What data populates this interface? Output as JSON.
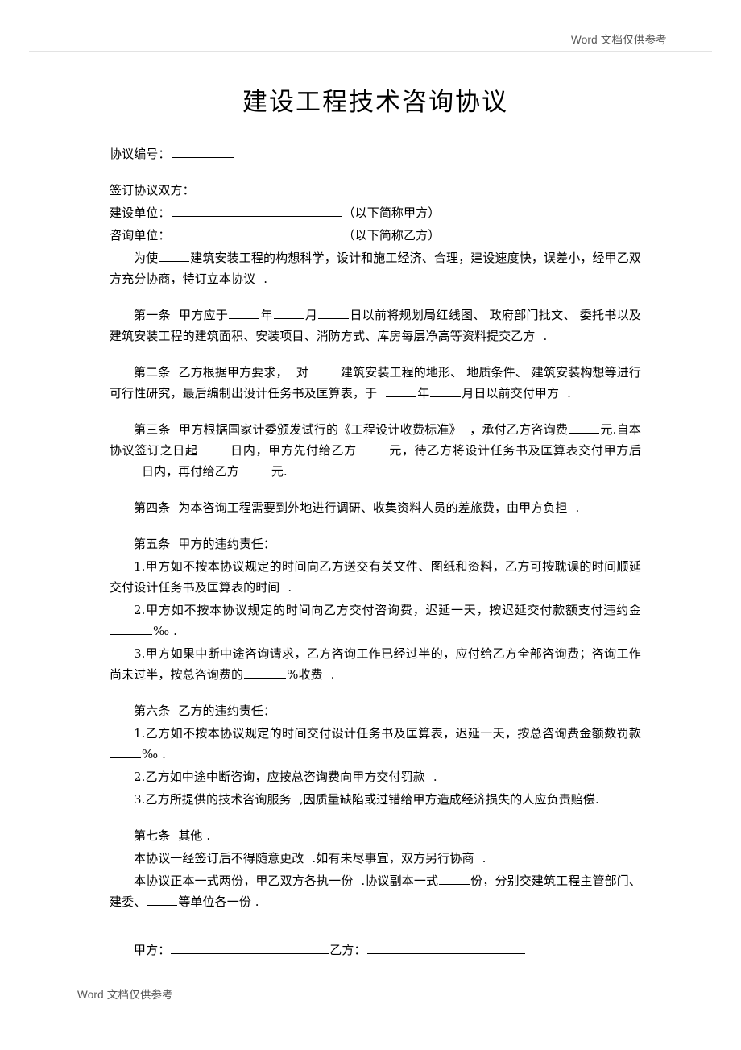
{
  "header": {
    "watermark": "Word 文档仅供参考"
  },
  "footer": {
    "watermark": "Word 文档仅供参考"
  },
  "document": {
    "title": "建设工程技术咨询协议",
    "number_label": "协议编号：",
    "parties_heading": "签订协议双方：",
    "party_a_label": "建设单位：",
    "party_a_note": "（以下简称甲方）",
    "party_b_label": "咨询单位：",
    "party_b_note": "（以下简称乙方）",
    "preamble": {
      "part1": "为使",
      "part2": "建筑安装工程的构想科学，设计和施工经济、合理，建设速度快，误差小，经甲乙双方充分协商，特订立本协议",
      "part3": "."
    },
    "article1": {
      "label": "第一条",
      "t1": "甲方应于",
      "t2": "年",
      "t3": "月",
      "t4": "日以前将规划局红线图、 政府部门批文、 委托书以及建筑安装工程的建筑面积、安装项目、消防方式、库房每层净高等资料提交乙方",
      "t5": "."
    },
    "article2": {
      "label": "第二条",
      "t1": "乙方根据甲方要求，",
      "t2": "对",
      "t3": "建筑安装工程的地形、 地质条件、 建筑安装构想等进行可行性研究，最后编制出设计任务书及匡算表，于",
      "t4": "年",
      "t5": "月日以前交付甲方",
      "t6": "."
    },
    "article3": {
      "label": "第三条",
      "t1": "甲方根据国家计委颁发试行的《工程设计收费标准》",
      "t2": "，承付乙方咨询费",
      "t3": "元.自本协议签订之日起",
      "t4": "日内，甲方先付给乙方",
      "t5": "元，待乙方将设计任务书及匡算表交付甲方后",
      "t6": "日内，再付给乙方",
      "t7": "元."
    },
    "article4": {
      "label": "第四条",
      "t1": "为本咨询工程需要到外地进行调研、收集资料人员的差旅费，由甲方负担",
      "t2": "."
    },
    "article5": {
      "label": "第五条",
      "heading": "甲方的违约责任：",
      "item1": "1.甲方如不按本协议规定的时间向乙方送交有关文件、图纸和资料，乙方可按耽误的时间顺延交付设计任务书及匡算表的时间",
      "item1_end": ".",
      "item2_a": "2.甲方如不按本协议规定的时间向乙方交付咨询费，迟延一天，按迟延交付款额支付违约金",
      "item2_unit": "‰ .",
      "item3_a": "3.甲方如果中断中途咨询请求，乙方咨询工作已经过半的，应付给乙方全部咨询费；咨询工作尚未过半，按总咨询费的",
      "item3_unit": "%收费",
      "item3_end": "."
    },
    "article6": {
      "label": "第六条",
      "heading": "乙方的违约责任：",
      "item1_a": "1.乙方如不按本协议规定的时间交付设计任务书及匡算表，迟延一天，按总咨询费金额数罚款",
      "item1_unit": "‰ .",
      "item2": "2.乙方如中途中断咨询，应按总咨询费向甲方交付罚款",
      "item2_end": ".",
      "item3_a": "3.乙方所提供的技术咨询服务",
      "item3_b": ",因质量缺陷或过错给甲方造成经济损失的人应负责赔偿",
      "item3_end": "."
    },
    "article7": {
      "label": "第七条",
      "heading": "其他 .",
      "line1_a": "本协议一经签订后不得随意更改",
      "line1_b": ".如有未尽事宜，双方另行协商",
      "line1_end": ".",
      "line2_a": "本协议正本一式两份，甲乙双方各执一份",
      "line2_b": ".协议副本一式",
      "line2_c": "份，分别交建筑工程主管部门、建委、",
      "line2_d": "等单位各一份 ."
    },
    "signature": {
      "party_a": "甲方：",
      "party_b": "乙方："
    }
  }
}
